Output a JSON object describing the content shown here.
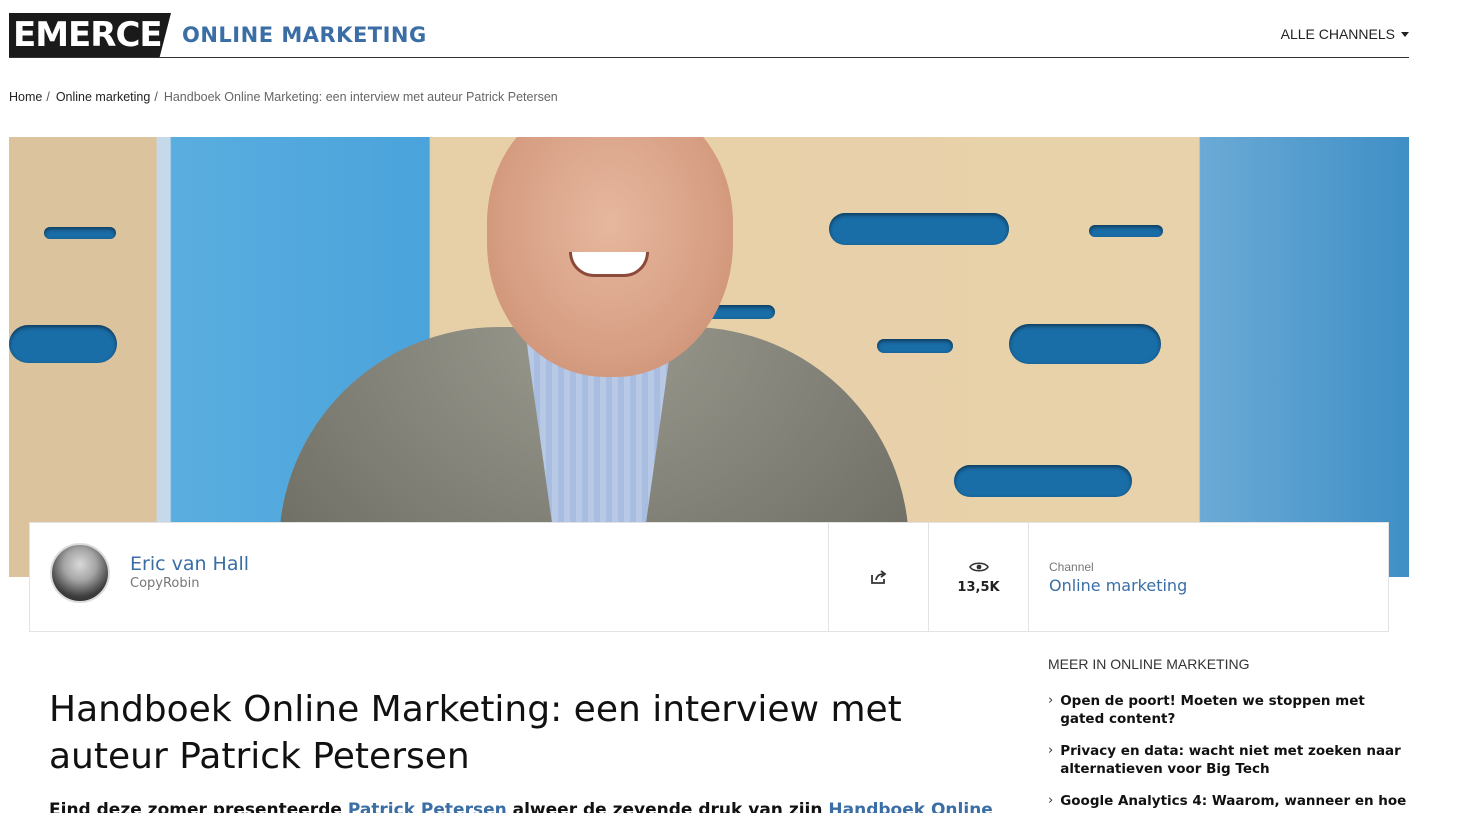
{
  "header": {
    "logo_text": "EMERCE",
    "channel_title": "ONLINE MARKETING",
    "all_channels_label": "ALLE CHANNELS"
  },
  "breadcrumb": {
    "items": [
      "Home",
      "Online marketing"
    ],
    "separator": "/",
    "current": "Handboek Online Marketing: een interview met auteur Patrick Petersen"
  },
  "author_bar": {
    "author_name": "Eric van Hall",
    "author_company": "CopyRobin",
    "views": "13,5K",
    "channel_label": "Channel",
    "channel_name": "Online marketing",
    "icons": [
      "share-icon",
      "eye-icon"
    ]
  },
  "article": {
    "title": "Handboek Online Marketing: een interview met auteur Patrick Petersen",
    "lead_part1": "Eind deze zomer presenteerde ",
    "lead_link1": "Patrick Petersen",
    "lead_part2": " alweer de zevende druk van zijn ",
    "lead_link2": "Handboek Online"
  },
  "sidebar": {
    "heading": "MEER IN ONLINE MARKETING",
    "items": [
      {
        "label": "Open de poort! Moeten we stoppen met gated content?"
      },
      {
        "label": "Privacy en data: wacht niet met zoeken naar alternatieven voor Big Tech"
      },
      {
        "label": "Google Analytics 4: Waarom, wanneer en hoe"
      }
    ]
  },
  "colors": {
    "accent": "#3a6ea5",
    "logo_bg": "#1a1a1a"
  }
}
